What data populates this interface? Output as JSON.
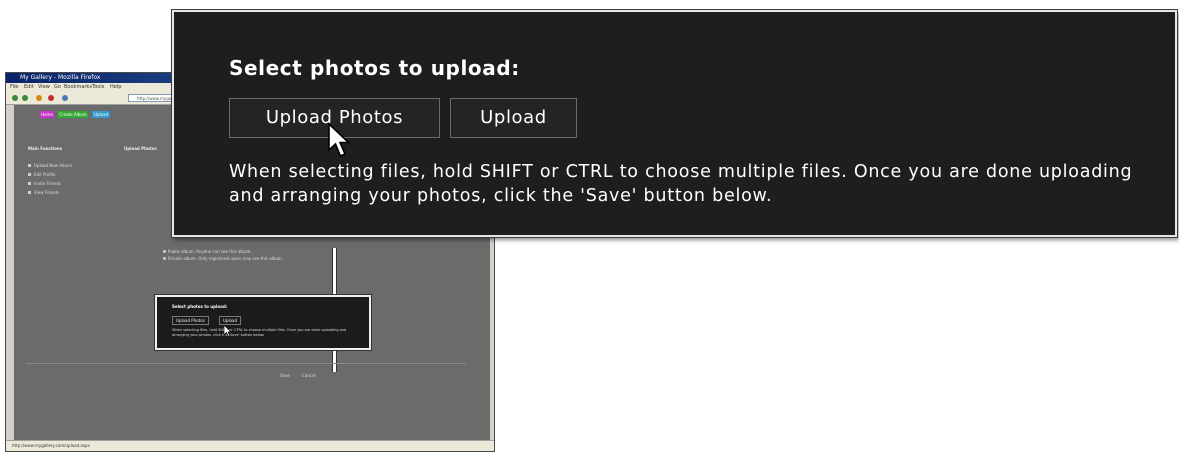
{
  "thumbnail": {
    "window_title": "My Gallery - Mozilla Firefox",
    "menu": [
      "File",
      "Edit",
      "View",
      "Go",
      "Bookmarks",
      "Tools",
      "Help"
    ],
    "address": "http://www.mygallery.com/upload.aspx",
    "tabs": [
      "Home",
      "Create Album",
      "Upload"
    ],
    "sidebar_heading": "Main Functions",
    "sidebar_items": [
      "Upload New Album",
      "Edit Profile",
      "Invite Friends",
      "View Friends"
    ],
    "main_heading": "Upload Photos",
    "privacy_options": [
      "Public album. Anyone can see this album.",
      "Private album. Only registered users may see this album."
    ],
    "mini_heading": "Select photos to upload:",
    "mini_buttons": [
      "Upload Photos",
      "Upload"
    ],
    "mini_help": "When selecting files, hold SHIFT or CTRL to choose multiple files. Once you are done uploading and arranging your photos, click the 'Save' button below.",
    "save_label": "Save",
    "cancel_label": "Cancel",
    "status": "http://www.mygallery.com/upload.aspx",
    "tab_colors": [
      "#cc33cc",
      "#33aa33",
      "#3399cc"
    ]
  },
  "callout": {
    "heading": "Select photos to upload:",
    "upload_photos_label": "Upload Photos",
    "upload_label": "Upload",
    "help_text": "When selecting files, hold SHIFT or CTRL to choose multiple files. Once you are done uploading and arranging your photos, click the 'Save' button below."
  },
  "colors": {
    "panel_background": "#1e1e1e",
    "panel_border": "#e6e6e6",
    "text": "#ffffff"
  },
  "icons": {
    "cursor": "mouse-pointer-icon"
  }
}
